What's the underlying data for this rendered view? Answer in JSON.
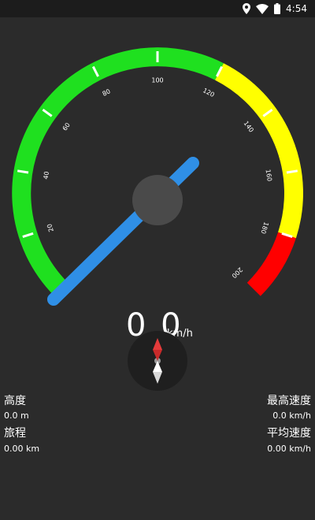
{
  "status_bar": {
    "time": "4:54",
    "icons": [
      "location-icon",
      "wifi-icon",
      "battery-icon"
    ]
  },
  "speedometer": {
    "current_speed": "0.0",
    "unit": "km/h",
    "tick_labels": [
      "20",
      "40",
      "60",
      "80",
      "100",
      "120",
      "140",
      "160",
      "180",
      "200"
    ],
    "colors": {
      "green_zone": "#1fe01f",
      "yellow_zone": "#ffff00",
      "red_zone": "#ff0000",
      "needle": "#2f8fe6",
      "hub": "#4a4a4a",
      "background": "#2b2b2b"
    }
  },
  "compass": {
    "icon": "compass-icon"
  },
  "stats": {
    "altitude_label": "高度",
    "altitude_value": "0.0 m",
    "trip_label": "旅程",
    "trip_value": "0.00 km",
    "max_speed_label": "最高速度",
    "max_speed_value": "0.0 km/h",
    "avg_speed_label": "平均速度",
    "avg_speed_value": "0.00 km/h"
  }
}
